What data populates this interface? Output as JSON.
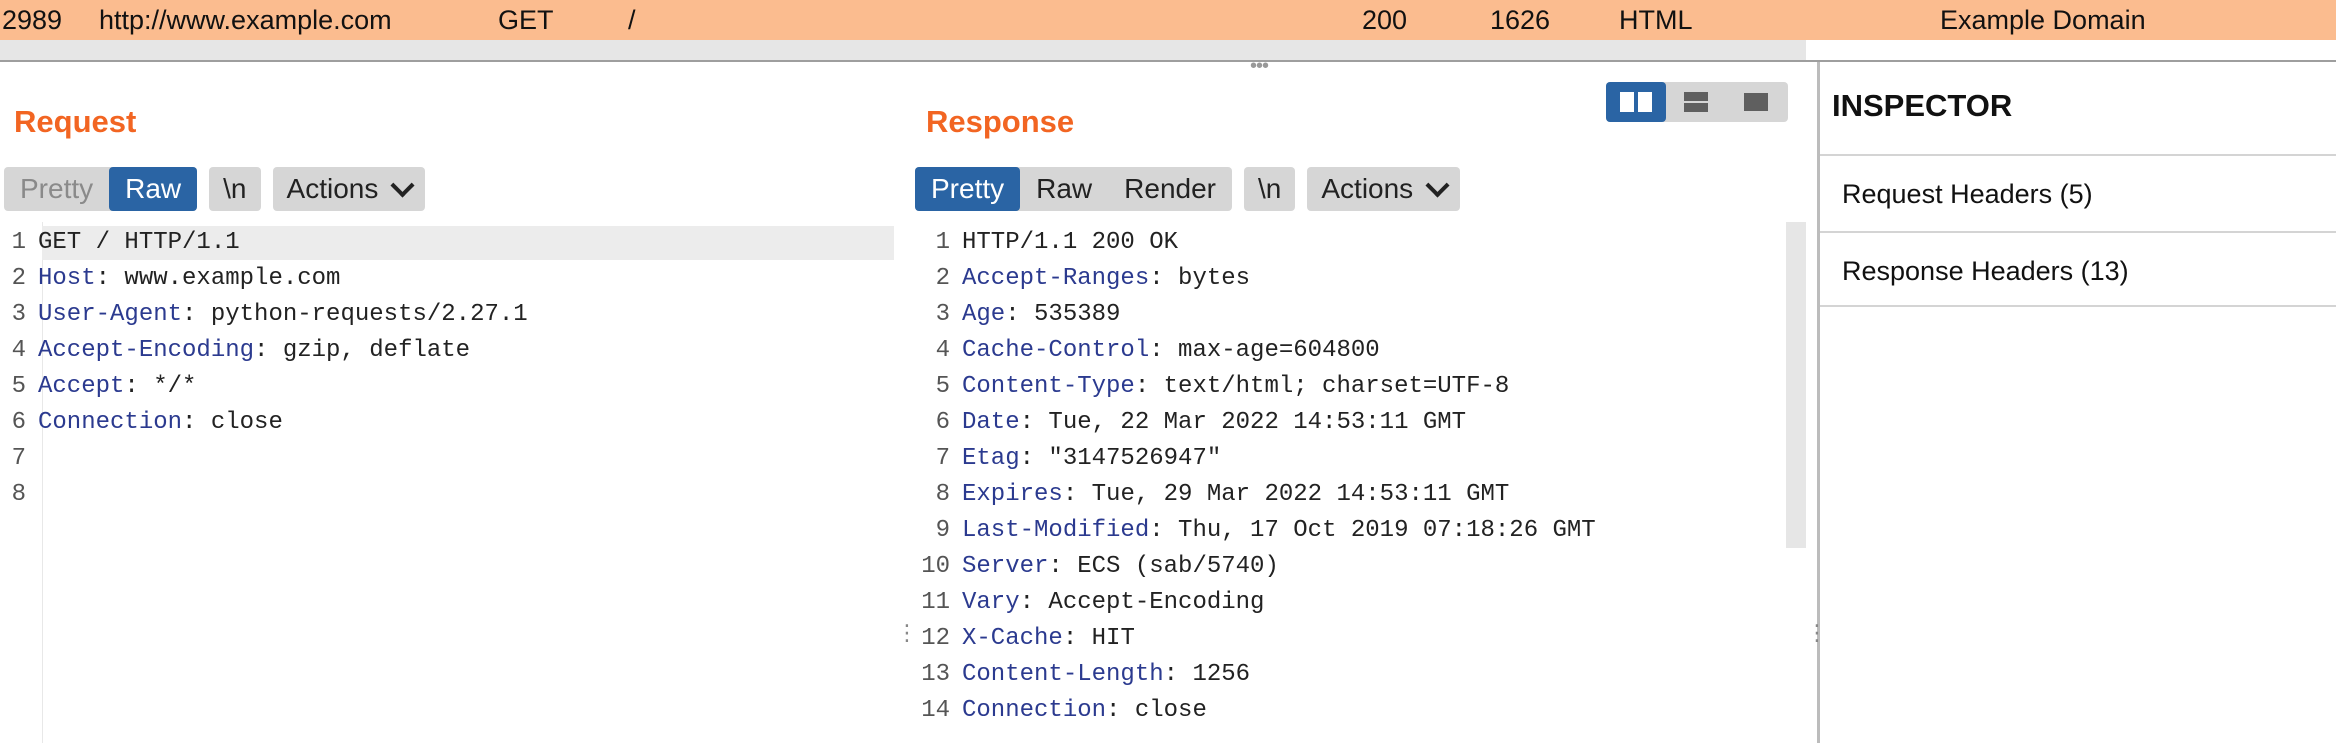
{
  "history_row": {
    "id": "2989",
    "host": "http://www.example.com",
    "method": "GET",
    "path": "/",
    "status": "200",
    "length": "1626",
    "mime": "HTML",
    "title": "Example Domain"
  },
  "request": {
    "title": "Request",
    "tabs": [
      "Pretty",
      "Raw"
    ],
    "active_tab": "Raw",
    "newline_label": "\\n",
    "actions_label": "Actions",
    "lines": [
      {
        "n": "1",
        "key": "",
        "value": "GET / HTTP/1.1"
      },
      {
        "n": "2",
        "key": "Host",
        "value": ": www.example.com"
      },
      {
        "n": "3",
        "key": "User-Agent",
        "value": ": python-requests/2.27.1"
      },
      {
        "n": "4",
        "key": "Accept-Encoding",
        "value": ": gzip, deflate"
      },
      {
        "n": "5",
        "key": "Accept",
        "value": ": */*"
      },
      {
        "n": "6",
        "key": "Connection",
        "value": ": close"
      },
      {
        "n": "7",
        "key": "",
        "value": ""
      },
      {
        "n": "8",
        "key": "",
        "value": ""
      }
    ]
  },
  "response": {
    "title": "Response",
    "tabs": [
      "Pretty",
      "Raw",
      "Render"
    ],
    "active_tab": "Pretty",
    "newline_label": "\\n",
    "actions_label": "Actions",
    "lines": [
      {
        "n": "1",
        "key": "",
        "value": "HTTP/1.1 200 OK"
      },
      {
        "n": "2",
        "key": "Accept-Ranges",
        "value": ": bytes"
      },
      {
        "n": "3",
        "key": "Age",
        "value": ": 535389"
      },
      {
        "n": "4",
        "key": "Cache-Control",
        "value": ": max-age=604800"
      },
      {
        "n": "5",
        "key": "Content-Type",
        "value": ": text/html; charset=UTF-8"
      },
      {
        "n": "6",
        "key": "Date",
        "value": ": Tue, 22 Mar 2022 14:53:11 GMT"
      },
      {
        "n": "7",
        "key": "Etag",
        "value": ": \"3147526947\""
      },
      {
        "n": "8",
        "key": "Expires",
        "value": ": Tue, 29 Mar 2022 14:53:11 GMT"
      },
      {
        "n": "9",
        "key": "Last-Modified",
        "value": ": Thu, 17 Oct 2019 07:18:26 GMT"
      },
      {
        "n": "10",
        "key": "Server",
        "value": ": ECS (sab/5740)"
      },
      {
        "n": "11",
        "key": "Vary",
        "value": ": Accept-Encoding"
      },
      {
        "n": "12",
        "key": "X-Cache",
        "value": ": HIT"
      },
      {
        "n": "13",
        "key": "Content-Length",
        "value": ": 1256"
      },
      {
        "n": "14",
        "key": "Connection",
        "value": ": close"
      }
    ]
  },
  "layout_toggle": {
    "options": [
      "side-by-side",
      "stacked",
      "single"
    ],
    "active": "side-by-side"
  },
  "inspector": {
    "title": "INSPECTOR",
    "sections": [
      "Request Headers (5)",
      "Response Headers (13)"
    ]
  },
  "colors": {
    "row_highlight": "#fbbc8f",
    "panel_title": "#f26522",
    "active_tab": "#2a64a4",
    "header_key": "#2b3a8f"
  }
}
